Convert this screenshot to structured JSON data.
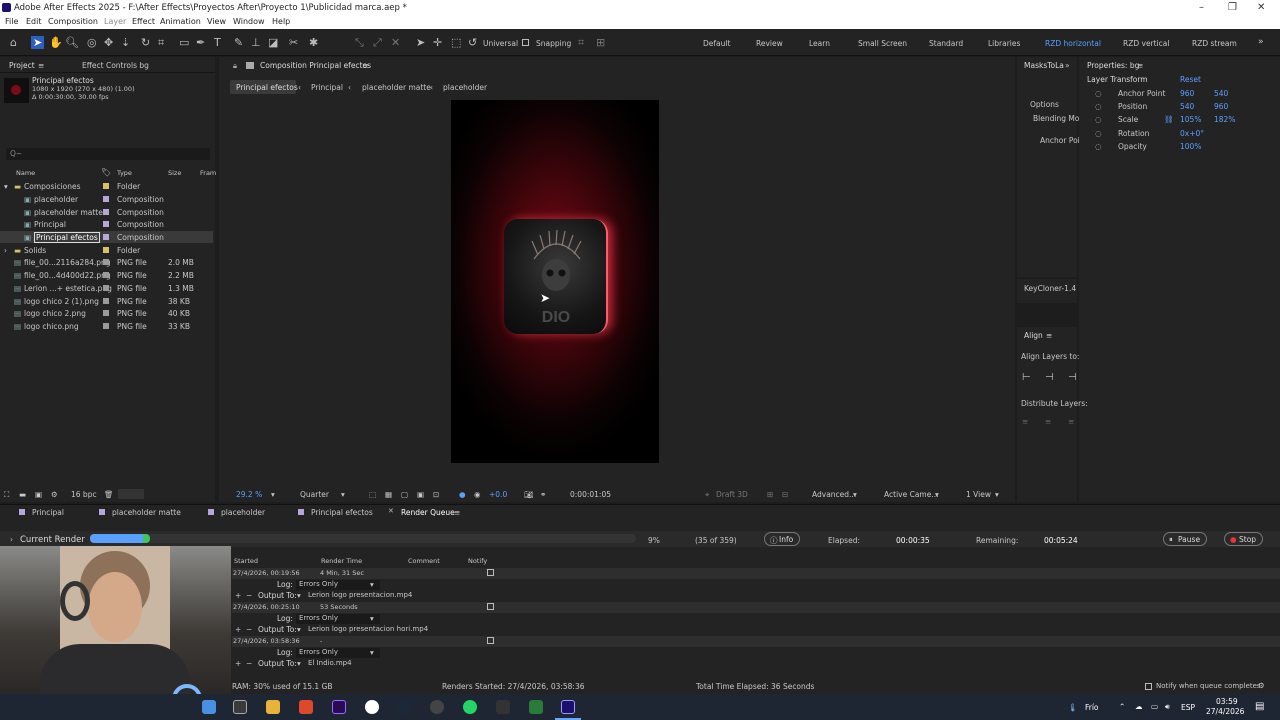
{
  "window": {
    "title": "Adobe After Effects 2025 - F:\\After Effects\\Proyectos After\\Proyecto 1\\Publicidad marca.aep *"
  },
  "menu": [
    "File",
    "Edit",
    "Composition",
    "Layer",
    "Effect",
    "Animation",
    "View",
    "Window",
    "Help"
  ],
  "toolbar": {
    "universal": "Universal",
    "snapping": "Snapping"
  },
  "workspaces": [
    "Default",
    "Review",
    "Learn",
    "Small Screen",
    "Standard",
    "Libraries",
    "RZD horizontal",
    "RZD vertical",
    "RZD stream"
  ],
  "project": {
    "tab_project": "Project",
    "tab_effect_controls": "Effect Controls bg",
    "selected_name": "Principal efectos",
    "selected_info1": "1080 x 1920 (270 x 480) (1.00)",
    "selected_info2": "Δ 0:00:30:00, 30.00 fps",
    "search_placeholder": "Q~",
    "cols": {
      "name": "Name",
      "type": "Type",
      "size": "Size",
      "frame": "Fram"
    },
    "items": [
      {
        "name": "Composiciones",
        "type": "Folder",
        "size": ""
      },
      {
        "name": "placeholder",
        "type": "Composition",
        "size": ""
      },
      {
        "name": "placeholder matte",
        "type": "Composition",
        "size": ""
      },
      {
        "name": "Principal",
        "type": "Composition",
        "size": ""
      },
      {
        "name": "Principal efectos",
        "type": "Composition",
        "size": ""
      },
      {
        "name": "Solids",
        "type": "Folder",
        "size": ""
      },
      {
        "name": "file_00...2116a284.png",
        "type": "PNG file",
        "size": "2.0 MB"
      },
      {
        "name": "file_00...4d400d22.png",
        "type": "PNG file",
        "size": "2.2 MB"
      },
      {
        "name": "Lerion ...+ estetica.png",
        "type": "PNG file",
        "size": "1.3 MB"
      },
      {
        "name": "logo chico 2 (1).png",
        "type": "PNG file",
        "size": "38 KB"
      },
      {
        "name": "logo chico 2.png",
        "type": "PNG file",
        "size": "40 KB"
      },
      {
        "name": "logo chico.png",
        "type": "PNG file",
        "size": "33 KB"
      }
    ],
    "bpc": "16 bpc"
  },
  "composition": {
    "tab": "Composition Principal efectos",
    "breadcrumbs": [
      "Principal efectos",
      "Principal",
      "placeholder matte",
      "placeholder"
    ],
    "zoom": "29.2 %",
    "resolution": "Quarter",
    "exposure": "+0.0",
    "timecode": "0:00:01:05",
    "renderer": "Draft 3D",
    "advanced": "Advanced...",
    "camera": "Active Came...",
    "view": "1 View"
  },
  "masks_panel": {
    "tab": "MasksToLa",
    "options": "Options",
    "blending": "Blending Mo",
    "anchor": "Anchor Poi"
  },
  "properties": {
    "tab": "Properties: bg",
    "section": "Layer Transform",
    "reset": "Reset",
    "anchor_label": "Anchor Point",
    "anchor_x": "960",
    "anchor_y": "540",
    "position_label": "Position",
    "position_x": "540",
    "position_y": "960",
    "scale_label": "Scale",
    "scale_x": "105%",
    "scale_y": "182%",
    "rotation_label": "Rotation",
    "rotation": "0x+0°",
    "opacity_label": "Opacity",
    "opacity": "100%"
  },
  "keycloner": "KeyCloner-1.4",
  "align": {
    "tab": "Align",
    "align_to": "Align Layers to:",
    "distribute": "Distribute Layers:"
  },
  "render": {
    "tabs": [
      "Principal",
      "placeholder matte",
      "placeholder",
      "Principal efectos",
      "Render Queue"
    ],
    "current_render": "Current Render",
    "progress_pct": 9,
    "progress_label": "9%",
    "frames": "(35 of 359)",
    "info_btn": "Info",
    "elapsed_label": "Elapsed:",
    "elapsed": "00:00:35",
    "remaining_label": "Remaining:",
    "remaining": "00:05:24",
    "pause_btn": "Pause",
    "stop_btn": "Stop",
    "cols": {
      "started": "Started",
      "render_time": "Render Time",
      "comment": "Comment",
      "notify": "Notify"
    },
    "items": [
      {
        "started": "27/4/2026, 00:19:56",
        "time": "4 Min, 31 Sec",
        "log": "Errors Only",
        "output": "Lerion logo presentacion.mp4"
      },
      {
        "started": "27/4/2026, 00:25:10",
        "time": "53 Seconds",
        "log": "Errors Only",
        "output": "Lerion logo presentacion hori.mp4"
      },
      {
        "started": "27/4/2026, 03:58:36",
        "time": "-",
        "log": "Errors Only",
        "output": "El Indio.mp4"
      }
    ],
    "log_label": "Log:",
    "output_label": "Output To:"
  },
  "status": {
    "ram": "RAM: 30% used of 15.1 GB",
    "renders_started": "Renders Started: 27/4/2026, 03:58:36",
    "total_elapsed": "Total Time Elapsed: 36 Seconds",
    "notify": "Notify when queue completes"
  },
  "taskbar": {
    "weather": "Frío",
    "lang": "ESP",
    "time": "03:59",
    "date": "27/4/2026"
  }
}
